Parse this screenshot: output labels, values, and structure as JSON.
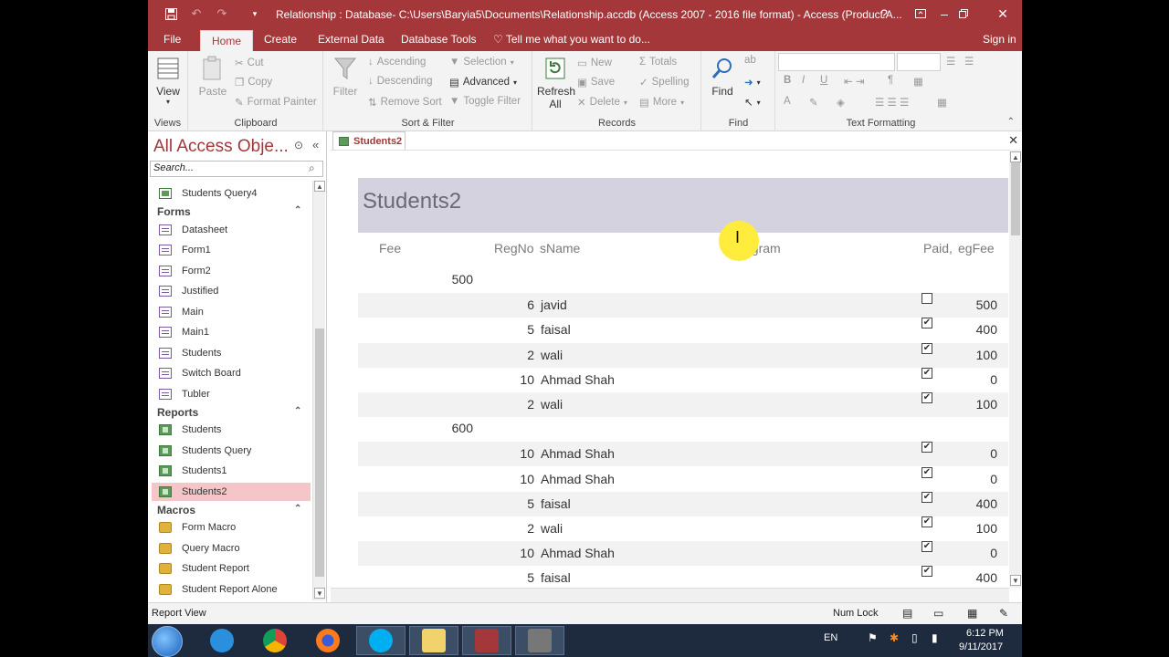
{
  "window": {
    "title": "Relationship : Database- C:\\Users\\Baryia5\\Documents\\Relationship.accdb (Access 2007 - 2016 file format) - Access (Product A...",
    "help": "?"
  },
  "ribbon_tabs": [
    {
      "label": "File"
    },
    {
      "label": "Home"
    },
    {
      "label": "Create"
    },
    {
      "label": "External Data"
    },
    {
      "label": "Database Tools"
    },
    {
      "label": "Tell me what you want to do..."
    }
  ],
  "signin": "Sign in",
  "ribbon": {
    "views": {
      "view_label": "View",
      "group": "Views"
    },
    "clipboard": {
      "paste": "Paste",
      "cut": "Cut",
      "copy": "Copy",
      "format_painter": "Format Painter",
      "group": "Clipboard"
    },
    "sort": {
      "filter": "Filter",
      "ascending": "Ascending",
      "descending": "Descending",
      "remove_sort": "Remove Sort",
      "selection": "Selection",
      "advanced": "Advanced",
      "toggle_filter": "Toggle Filter",
      "group": "Sort & Filter"
    },
    "records": {
      "refresh": "Refresh",
      "refresh2": "All",
      "new": "New",
      "save": "Save",
      "delete": "Delete",
      "totals": "Totals",
      "spelling": "Spelling",
      "more": "More",
      "group": "Records"
    },
    "find": {
      "find": "Find",
      "group": "Find"
    },
    "text": {
      "group": "Text Formatting",
      "bold": "B",
      "italic": "I",
      "underline": "U",
      "font_color": "A"
    }
  },
  "nav": {
    "title": "All Access Obje...",
    "search_placeholder": "Search...",
    "query_item": "Students Query4",
    "forms_header": "Forms",
    "forms": [
      "Datasheet",
      "Form1",
      "Form2",
      "Justified",
      "Main",
      "Main1",
      "Students",
      "Switch Board",
      "Tubler"
    ],
    "reports_header": "Reports",
    "reports": [
      "Students",
      "Students Query",
      "Students1",
      "Students2"
    ],
    "macros_header": "Macros",
    "macros": [
      "Form Macro",
      "Query Macro",
      "Student Report",
      "Student Report Alone"
    ]
  },
  "document": {
    "tab": "Students2",
    "report_title": "Students2",
    "headers": {
      "fee": "Fee",
      "regno": "RegNo",
      "sname": "sName",
      "program": "Program",
      "paid": "Paid,",
      "egfee": "egFee"
    },
    "groups": [
      {
        "fee": "500",
        "rows": [
          {
            "regno": "6",
            "name": "javid",
            "paid": "",
            "fee": "500"
          },
          {
            "regno": "5",
            "name": "faisal",
            "paid": "✔",
            "fee": "400"
          },
          {
            "regno": "2",
            "name": "wali",
            "paid": "✔",
            "fee": "100"
          },
          {
            "regno": "10",
            "name": "Ahmad Shah",
            "paid": "✔",
            "fee": "0"
          },
          {
            "regno": "2",
            "name": "wali",
            "paid": "✔",
            "fee": "100"
          }
        ]
      },
      {
        "fee": "600",
        "rows": [
          {
            "regno": "10",
            "name": "Ahmad Shah",
            "paid": "✔",
            "fee": "0"
          },
          {
            "regno": "10",
            "name": "Ahmad Shah",
            "paid": "✔",
            "fee": "0"
          },
          {
            "regno": "5",
            "name": "faisal",
            "paid": "✔",
            "fee": "400"
          },
          {
            "regno": "2",
            "name": "wali",
            "paid": "✔",
            "fee": "100"
          },
          {
            "regno": "10",
            "name": "Ahmad Shah",
            "paid": "✔",
            "fee": "0"
          },
          {
            "regno": "5",
            "name": "faisal",
            "paid": "✔",
            "fee": "400"
          }
        ]
      }
    ]
  },
  "status": {
    "left": "Report View",
    "numlock": "Num Lock"
  },
  "taskbar": {
    "lang": "EN",
    "time": "6:12 PM",
    "date": "9/11/2017"
  },
  "colors": {
    "accent": "#a4373a",
    "selection": "#f4c6c8",
    "title_band": "#d4d2de"
  }
}
